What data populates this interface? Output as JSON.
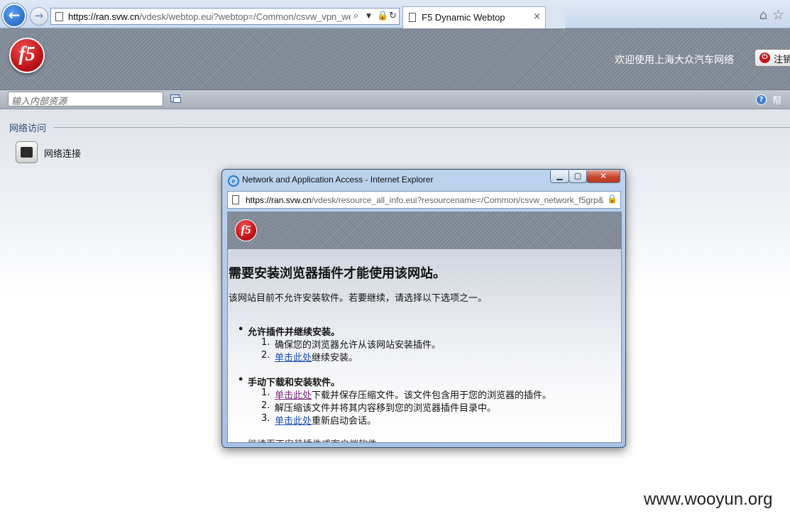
{
  "browser": {
    "address_host": "https://ran.svw.cn",
    "address_path": "/vdesk/webtop.eui?webtop=/Common/csvw_vpn_webtc",
    "tab_title": "F5 Dynamic Webtop",
    "search_glyph": "⌕",
    "lock_glyph": "🔒",
    "refresh_glyph": "↻",
    "close_glyph": "×"
  },
  "header": {
    "logo_text": "f5",
    "welcome_text": "欢迎使用上海大众汽车网络",
    "logout_label": "注销"
  },
  "toolbar": {
    "search_placeholder": "输入内部资源",
    "help_label": "帮助"
  },
  "main": {
    "section_title": "网络访问",
    "resource_label": "网络连接"
  },
  "popup": {
    "title": "Network and Application Access - Internet Explorer",
    "address_host": "https://ran.svw.cn",
    "address_path": "/vdesk/resource_all_info.eui?resourcename=/Common/csvw_network_f5grp&",
    "logo_text": "f5",
    "heading": "需要安装浏览器插件才能使用该网站。",
    "intro": "该网站目前不允许安装软件。若要继续，请选择以下选项之一。",
    "option1": {
      "title": "允许插件并继续安装。",
      "steps": [
        {
          "num": "1.",
          "text": "确保您的浏览器允许从该网站安装插件。"
        },
        {
          "num": "2.",
          "link": "单击此处",
          "text": "继续安装。"
        }
      ]
    },
    "option2": {
      "title": "手动下载和安装软件。",
      "steps": [
        {
          "num": "1.",
          "link": "单击此处",
          "text": "下载并保存压缩文件。该文件包含用于您的浏览器的插件。"
        },
        {
          "num": "2.",
          "text": "解压缩该文件并将其内容移到您的浏览器插件目录中。"
        },
        {
          "num": "3.",
          "link": "单击此处",
          "text": "重新启动会话。"
        }
      ]
    },
    "option3_partial": "继续而不安装插件或客户端软件。"
  },
  "watermark": "www.wooyun.org",
  "colors": {
    "f5_red": "#c01418",
    "link_blue": "#1a4fb1",
    "link_visited": "#7a2a7a"
  }
}
